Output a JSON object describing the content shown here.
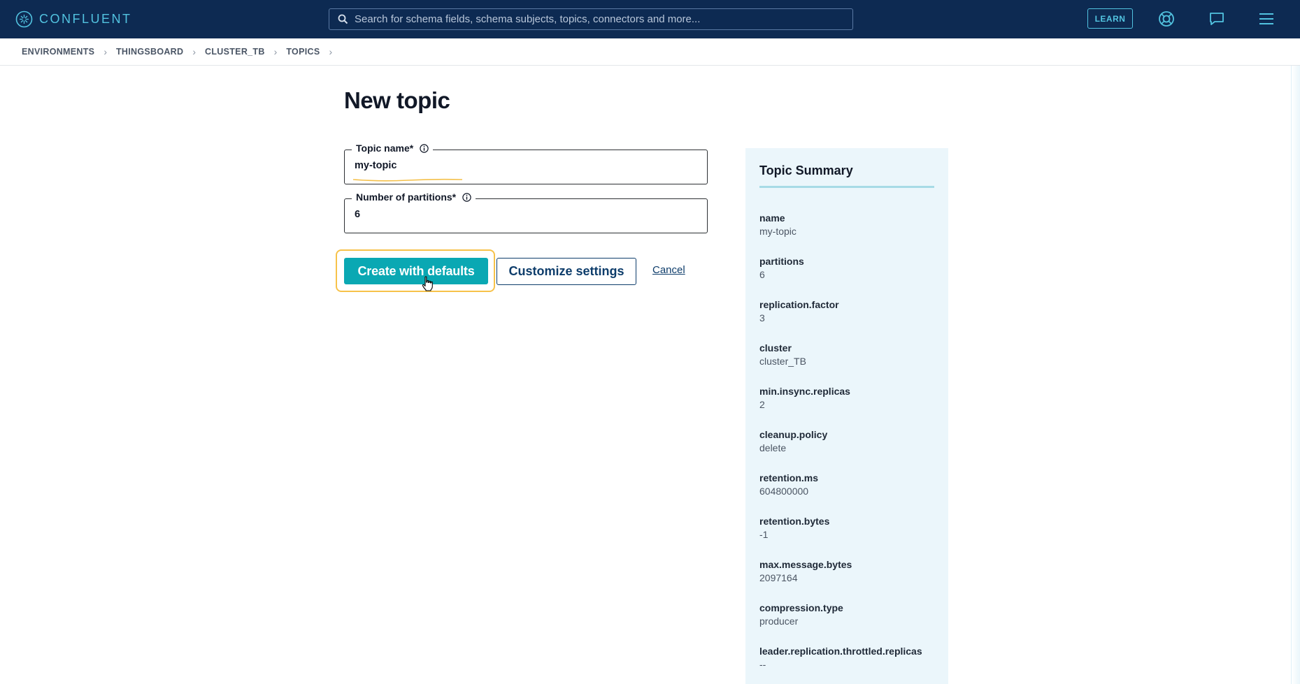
{
  "topbar": {
    "brand": "CONFLUENT",
    "search_placeholder": "Search for schema fields, schema subjects, topics, connectors and more...",
    "learn_label": "LEARN",
    "icons": [
      "search-icon",
      "help-lifebuoy-icon",
      "chat-icon",
      "menu-icon"
    ]
  },
  "breadcrumb": {
    "items": [
      "ENVIRONMENTS",
      "THINGSBOARD",
      "CLUSTER_TB",
      "TOPICS"
    ],
    "separator": "›"
  },
  "main": {
    "title": "New topic",
    "topic_name": {
      "label": "Topic name*",
      "value": "my-topic"
    },
    "partitions": {
      "label": "Number of partitions*",
      "value": "6"
    },
    "create_label": "Create with defaults",
    "customize_label": "Customize settings",
    "cancel_label": "Cancel"
  },
  "summary": {
    "title": "Topic Summary",
    "items": [
      {
        "key": "name",
        "value": "my-topic"
      },
      {
        "key": "partitions",
        "value": "6"
      },
      {
        "key": "replication.factor",
        "value": "3"
      },
      {
        "key": "cluster",
        "value": "cluster_TB"
      },
      {
        "key": "min.insync.replicas",
        "value": "2"
      },
      {
        "key": "cleanup.policy",
        "value": "delete"
      },
      {
        "key": "retention.ms",
        "value": "604800000"
      },
      {
        "key": "retention.bytes",
        "value": "-1"
      },
      {
        "key": "max.message.bytes",
        "value": "2097164"
      },
      {
        "key": "compression.type",
        "value": "producer"
      },
      {
        "key": "leader.replication.throttled.replicas",
        "value": "--"
      }
    ]
  },
  "colors": {
    "topbar_bg": "#0d2a52",
    "brand_accent": "#52c3e0",
    "primary_button": "#0aa8b3",
    "focus_ring": "#f7c24a",
    "summary_bg": "#ebf6fb"
  }
}
